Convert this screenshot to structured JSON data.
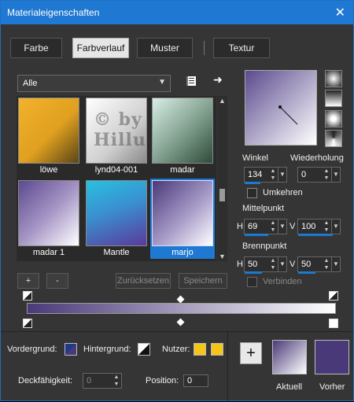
{
  "window": {
    "title": "Materialeigenschaften",
    "close_glyph": "✕"
  },
  "tabs": [
    "Farbe",
    "Farbverlauf",
    "Muster",
    "Textur"
  ],
  "library": {
    "category": "Alle",
    "tiles": [
      {
        "label": "löwe"
      },
      {
        "label": "lynd04-001"
      },
      {
        "label": "madar"
      },
      {
        "label": "madar 1"
      },
      {
        "label": "Mantle"
      },
      {
        "label": "marjo"
      }
    ],
    "watermark": [
      "© by",
      "Hillu"
    ],
    "add_glyph": "+",
    "remove_glyph": "-",
    "reset_label": "Zurücksetzen",
    "save_label": "Speichern",
    "book_icon": "book-icon",
    "arrow_icon": "arrow-right-icon"
  },
  "settings": {
    "angle_label": "Winkel",
    "angle_value": "134",
    "repeat_label": "Wiederholung",
    "repeat_value": "0",
    "invert_label": "Umkehren",
    "center_label": "Mittelpunkt",
    "center_h_label": "H",
    "center_h_value": "69",
    "center_v_label": "V",
    "center_v_value": "100",
    "focal_label": "Brennpunkt",
    "focal_h_label": "H",
    "focal_h_value": "50",
    "focal_v_label": "V",
    "focal_v_value": "50",
    "link_label": "Verbinden"
  },
  "footer": {
    "fg_label": "Vordergrund:",
    "bg_label": "Hintergrund:",
    "user_label": "Nutzer:",
    "opacity_label": "Deckfähigkeit:",
    "opacity_value": "0",
    "position_label": "Position:",
    "position_value": "0",
    "current_label": "Aktuell",
    "previous_label": "Vorher",
    "plus_glyph": "+"
  },
  "colors": {
    "accent": "#1f78d1",
    "gradient_start": "#4a3978",
    "gradient_end": "#ffffff",
    "user_swatch": "#f5c518",
    "previous_swatch": "#4a3978"
  }
}
